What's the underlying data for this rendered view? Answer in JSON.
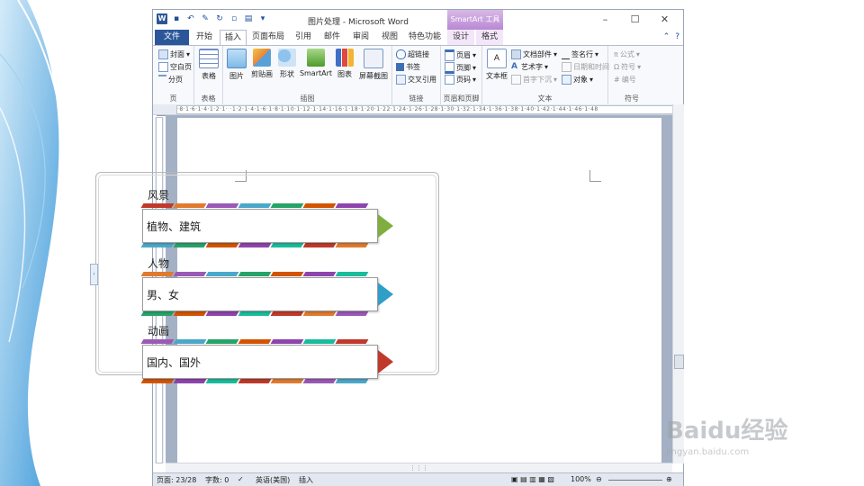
{
  "window": {
    "title": "图片处理 - Microsoft Word",
    "contextual_tab_group": "SmartArt 工具"
  },
  "tabs": [
    "文件",
    "开始",
    "插入",
    "页面布局",
    "引用",
    "邮件",
    "审阅",
    "视图",
    "特色功能",
    "设计",
    "格式"
  ],
  "active_tab": "插入",
  "ribbon": {
    "pages": {
      "label": "页",
      "items": [
        "封面",
        "空白页",
        "分页"
      ]
    },
    "tables": {
      "label": "表格",
      "button": "表格"
    },
    "illustrations": {
      "label": "插图",
      "buttons": [
        "图片",
        "剪贴画",
        "形状",
        "SmartArt",
        "图表",
        "屏幕截图"
      ]
    },
    "links": {
      "label": "链接",
      "items": [
        "超链接",
        "书签",
        "交叉引用"
      ]
    },
    "header_footer": {
      "label": "页眉和页脚",
      "items": [
        "页眉",
        "页脚",
        "页码"
      ]
    },
    "text": {
      "label": "文本",
      "textbox": "文本框",
      "items": [
        "文档部件",
        "艺术字",
        "首字下沉",
        "签名行",
        "日期和时间",
        "对象"
      ]
    },
    "symbols": {
      "label": "符号",
      "items": [
        "公式",
        "符号",
        "编号"
      ]
    }
  },
  "document": {
    "sections": [
      {
        "heading": "风景",
        "text": "植物、建筑",
        "arrow_color": "#7fae3e"
      },
      {
        "heading": "人物",
        "text": "男、女",
        "arrow_color": "#2f9fc8"
      },
      {
        "heading": "动画",
        "text": "国内、国外",
        "arrow_color": "#c0392b"
      }
    ],
    "stripe_colors": [
      "#c0392b",
      "#e07a2e",
      "#9b59b6",
      "#4aa8c9",
      "#27a36a",
      "#d35400",
      "#8e44ad",
      "#1abc9c"
    ]
  },
  "status_bar": {
    "page": "页面: 23/28",
    "words": "字数: 0",
    "language": "英语(美国)",
    "mode": "插入",
    "zoom": "100%"
  },
  "watermark": {
    "brand": "Baidu经验",
    "url": "jingyan.baidu.com"
  }
}
